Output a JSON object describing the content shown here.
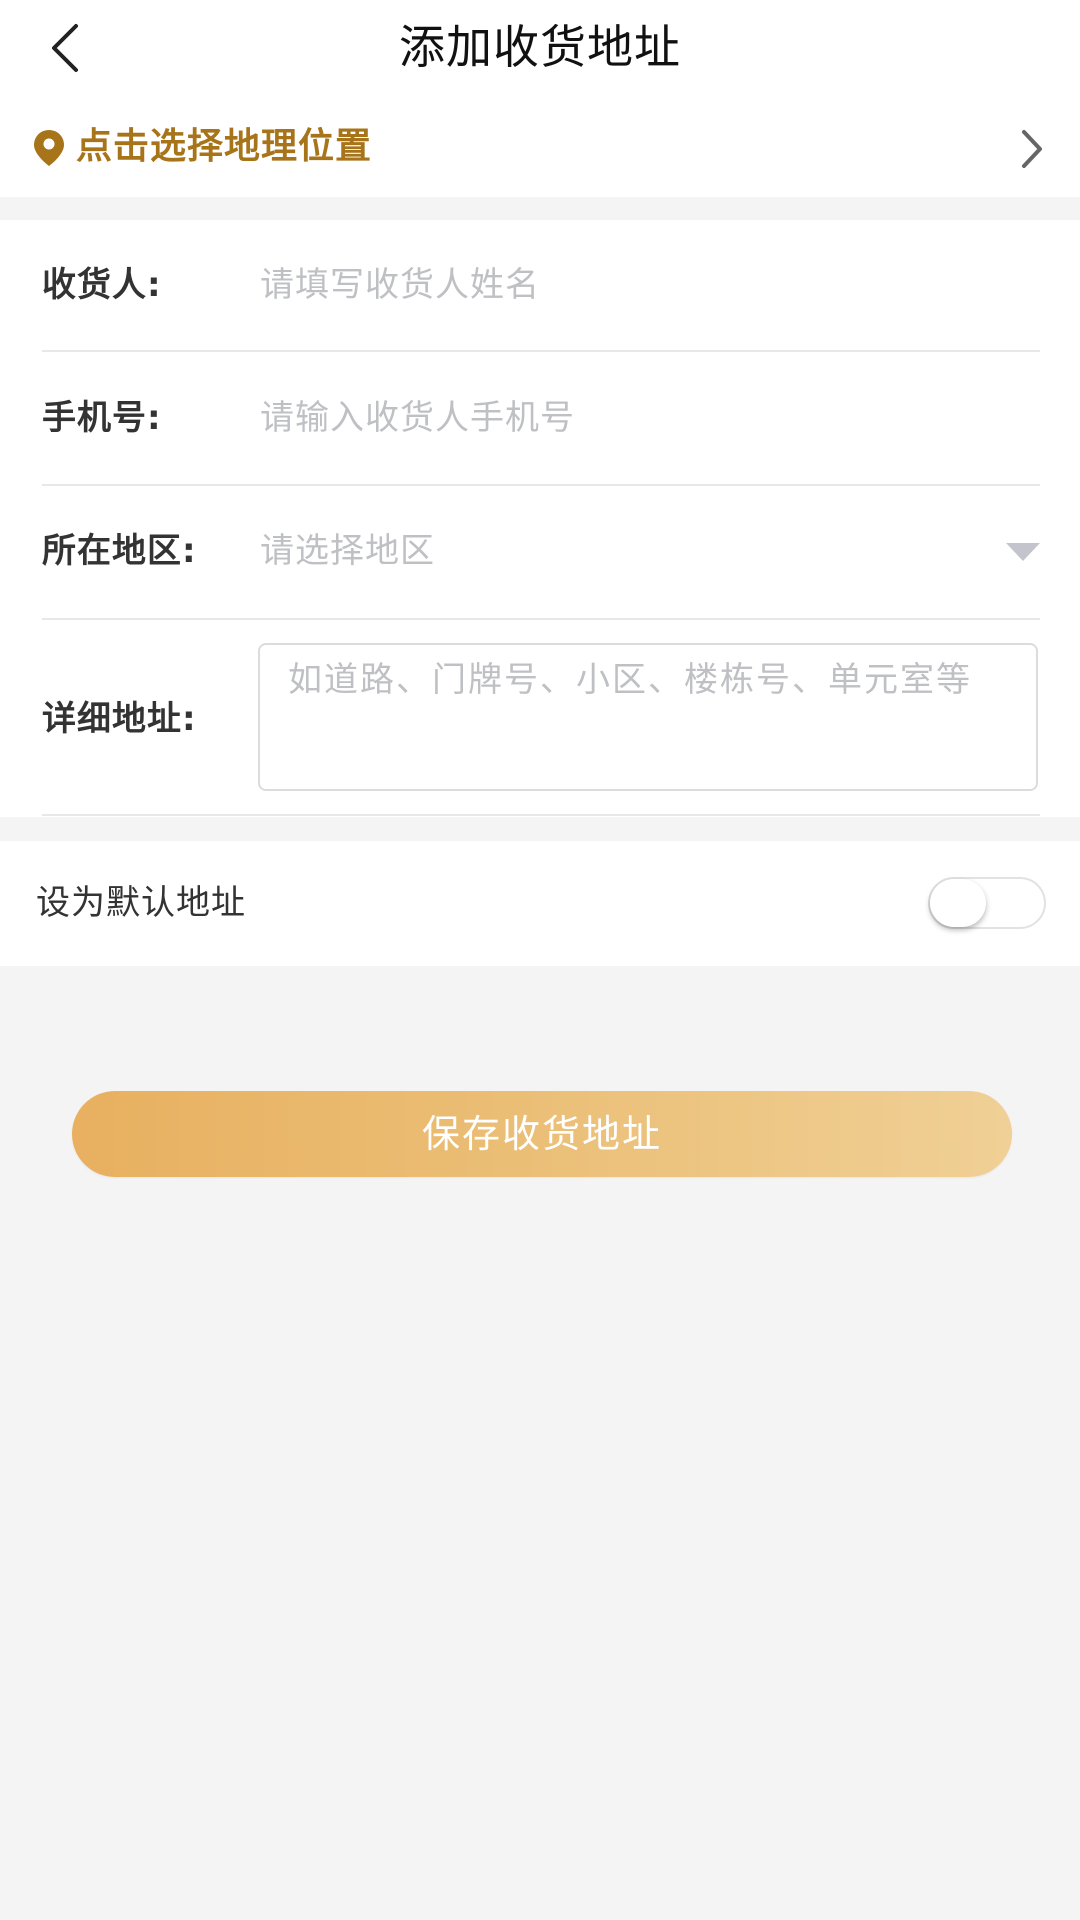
{
  "header": {
    "title": "添加收货地址",
    "back_icon": "chevron-left-icon"
  },
  "location": {
    "label": "点击选择地理位置",
    "icon": "map-pin-icon",
    "accent_color": "#a8741a"
  },
  "form": {
    "consignee": {
      "label": "收货人:",
      "placeholder": "请填写收货人姓名"
    },
    "phone": {
      "label": "手机号:",
      "placeholder": "请输入收货人手机号"
    },
    "region": {
      "label": "所在地区:",
      "placeholder": "请选择地区"
    },
    "address": {
      "label": "详细地址:",
      "placeholder": "如道路、门牌号、小区、楼栋号、单元室等"
    }
  },
  "default_address": {
    "label": "设为默认地址",
    "enabled": false
  },
  "save_button": {
    "label": "保存收货地址",
    "gradient_start": "#e8b060",
    "gradient_end": "#f0d096"
  }
}
